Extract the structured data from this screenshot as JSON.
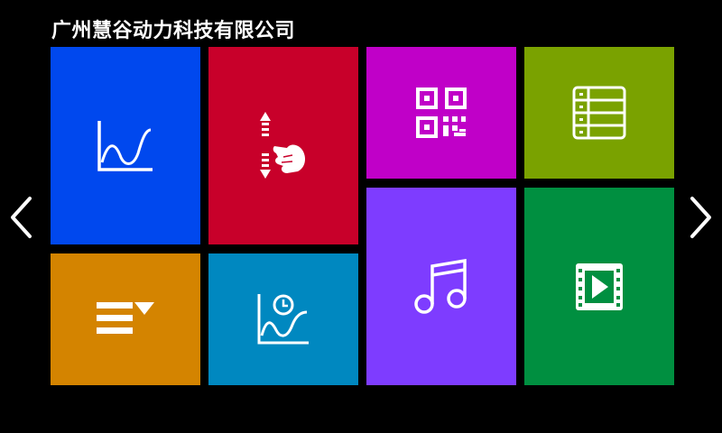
{
  "header": {
    "title": "广州慧谷动力科技有限公司"
  },
  "colors": {
    "background": "#000000",
    "tile_chart": "#0048EE",
    "tile_scroll": "#C8002A",
    "tile_qrcode": "#C000C8",
    "tile_table": "#7AA200",
    "tile_list": "#D48400",
    "tile_history_chart": "#0088C0",
    "tile_music": "#7E3CFF",
    "tile_video": "#008F40",
    "icon": "#FFFFFF"
  },
  "tiles": [
    {
      "id": "chart",
      "icon": "line-chart-icon"
    },
    {
      "id": "scroll",
      "icon": "scroll-gesture-icon"
    },
    {
      "id": "qrcode",
      "icon": "qr-code-icon"
    },
    {
      "id": "table",
      "icon": "table-list-icon"
    },
    {
      "id": "list",
      "icon": "dropdown-list-icon"
    },
    {
      "id": "history_chart",
      "icon": "history-curve-icon"
    },
    {
      "id": "music",
      "icon": "music-note-icon"
    },
    {
      "id": "video",
      "icon": "video-play-icon"
    }
  ],
  "navigation": {
    "prev_icon": "chevron-left-icon",
    "next_icon": "chevron-right-icon"
  }
}
